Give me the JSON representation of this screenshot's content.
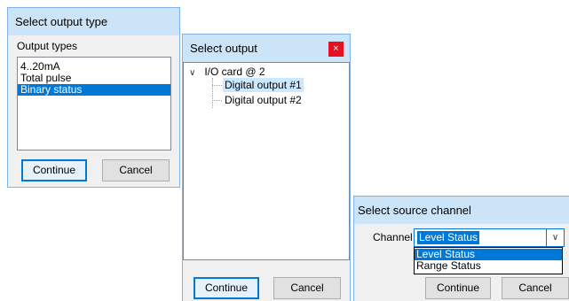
{
  "dialog1": {
    "title": "Select output type",
    "group_label": "Output types",
    "items": [
      "4..20mA",
      "Total pulse",
      "Binary status"
    ],
    "selected_index": 2,
    "continue_label": "Continue",
    "cancel_label": "Cancel"
  },
  "dialog2": {
    "title": "Select output",
    "close_glyph": "×",
    "tree": {
      "expander_glyph": "∨",
      "root": "I/O card @ 2",
      "children": [
        "Digital output #1",
        "Digital output #2"
      ],
      "selected_child": 0
    },
    "continue_label": "Continue",
    "cancel_label": "Cancel"
  },
  "dialog3": {
    "title": "Select source channel",
    "channel_label": "Channel",
    "selected_value": "Level Status",
    "arrow_glyph": "∨",
    "options": [
      "Level Status",
      "Range Status"
    ],
    "continue_label": "Continue",
    "cancel_label": "Cancel"
  },
  "colors": {
    "titlebar": "#cce4f7",
    "selection": "#0078d7",
    "tree_selection": "#cce8ff",
    "close_button": "#e81123",
    "dialog_bg": "#f0f0f0"
  }
}
